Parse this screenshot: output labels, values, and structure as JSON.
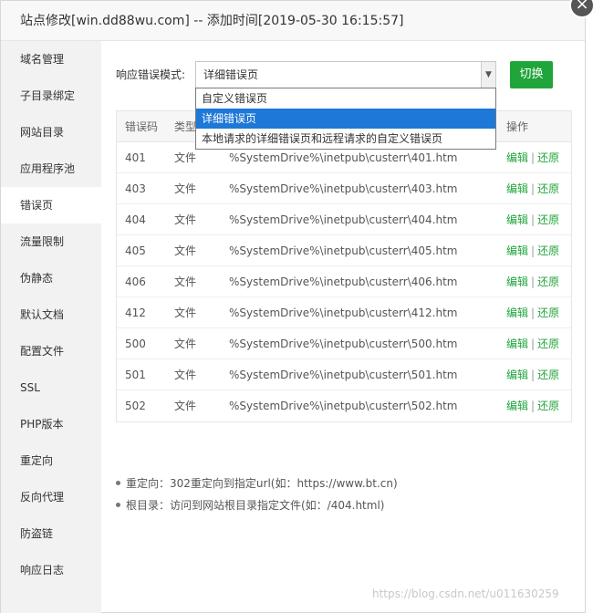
{
  "dialog": {
    "title": "站点修改[win.dd88wu.com] -- 添加时间[2019-05-30 16:15:57]",
    "close_glyph": "×"
  },
  "sidebar": {
    "items": [
      {
        "label": "域名管理"
      },
      {
        "label": "子目录绑定"
      },
      {
        "label": "网站目录"
      },
      {
        "label": "应用程序池"
      },
      {
        "label": "错误页",
        "active": true
      },
      {
        "label": "流量限制"
      },
      {
        "label": "伪静态"
      },
      {
        "label": "默认文档"
      },
      {
        "label": "配置文件"
      },
      {
        "label": "SSL"
      },
      {
        "label": "PHP版本"
      },
      {
        "label": "重定向"
      },
      {
        "label": "反向代理"
      },
      {
        "label": "防盗链"
      },
      {
        "label": "响应日志"
      }
    ]
  },
  "mode": {
    "label": "响应错误模式:",
    "selected": "详细错误页",
    "options": [
      "自定义错误页",
      "详细错误页",
      "本地请求的详细错误页和远程请求的自定义错误页"
    ],
    "switch_label": "切换"
  },
  "table": {
    "headers": {
      "code": "错误码",
      "type": "类型",
      "path": "",
      "op": "操作"
    },
    "edit_label": "编辑",
    "restore_label": "还原",
    "separator": "|",
    "rows": [
      {
        "code": "401",
        "type": "文件",
        "path": "%SystemDrive%\\inetpub\\custerr\\401.htm"
      },
      {
        "code": "403",
        "type": "文件",
        "path": "%SystemDrive%\\inetpub\\custerr\\403.htm"
      },
      {
        "code": "404",
        "type": "文件",
        "path": "%SystemDrive%\\inetpub\\custerr\\404.htm"
      },
      {
        "code": "405",
        "type": "文件",
        "path": "%SystemDrive%\\inetpub\\custerr\\405.htm"
      },
      {
        "code": "406",
        "type": "文件",
        "path": "%SystemDrive%\\inetpub\\custerr\\406.htm"
      },
      {
        "code": "412",
        "type": "文件",
        "path": "%SystemDrive%\\inetpub\\custerr\\412.htm"
      },
      {
        "code": "500",
        "type": "文件",
        "path": "%SystemDrive%\\inetpub\\custerr\\500.htm"
      },
      {
        "code": "501",
        "type": "文件",
        "path": "%SystemDrive%\\inetpub\\custerr\\501.htm"
      },
      {
        "code": "502",
        "type": "文件",
        "path": "%SystemDrive%\\inetpub\\custerr\\502.htm"
      }
    ]
  },
  "notes": [
    "重定向：302重定向到指定url(如：https://www.bt.cn)",
    "根目录：访问到网站根目录指定文件(如：/404.html)"
  ],
  "watermark": "https://blog.csdn.net/u011630259",
  "colors": {
    "accent": "#20a53a",
    "select_highlight": "#1e78d7"
  }
}
